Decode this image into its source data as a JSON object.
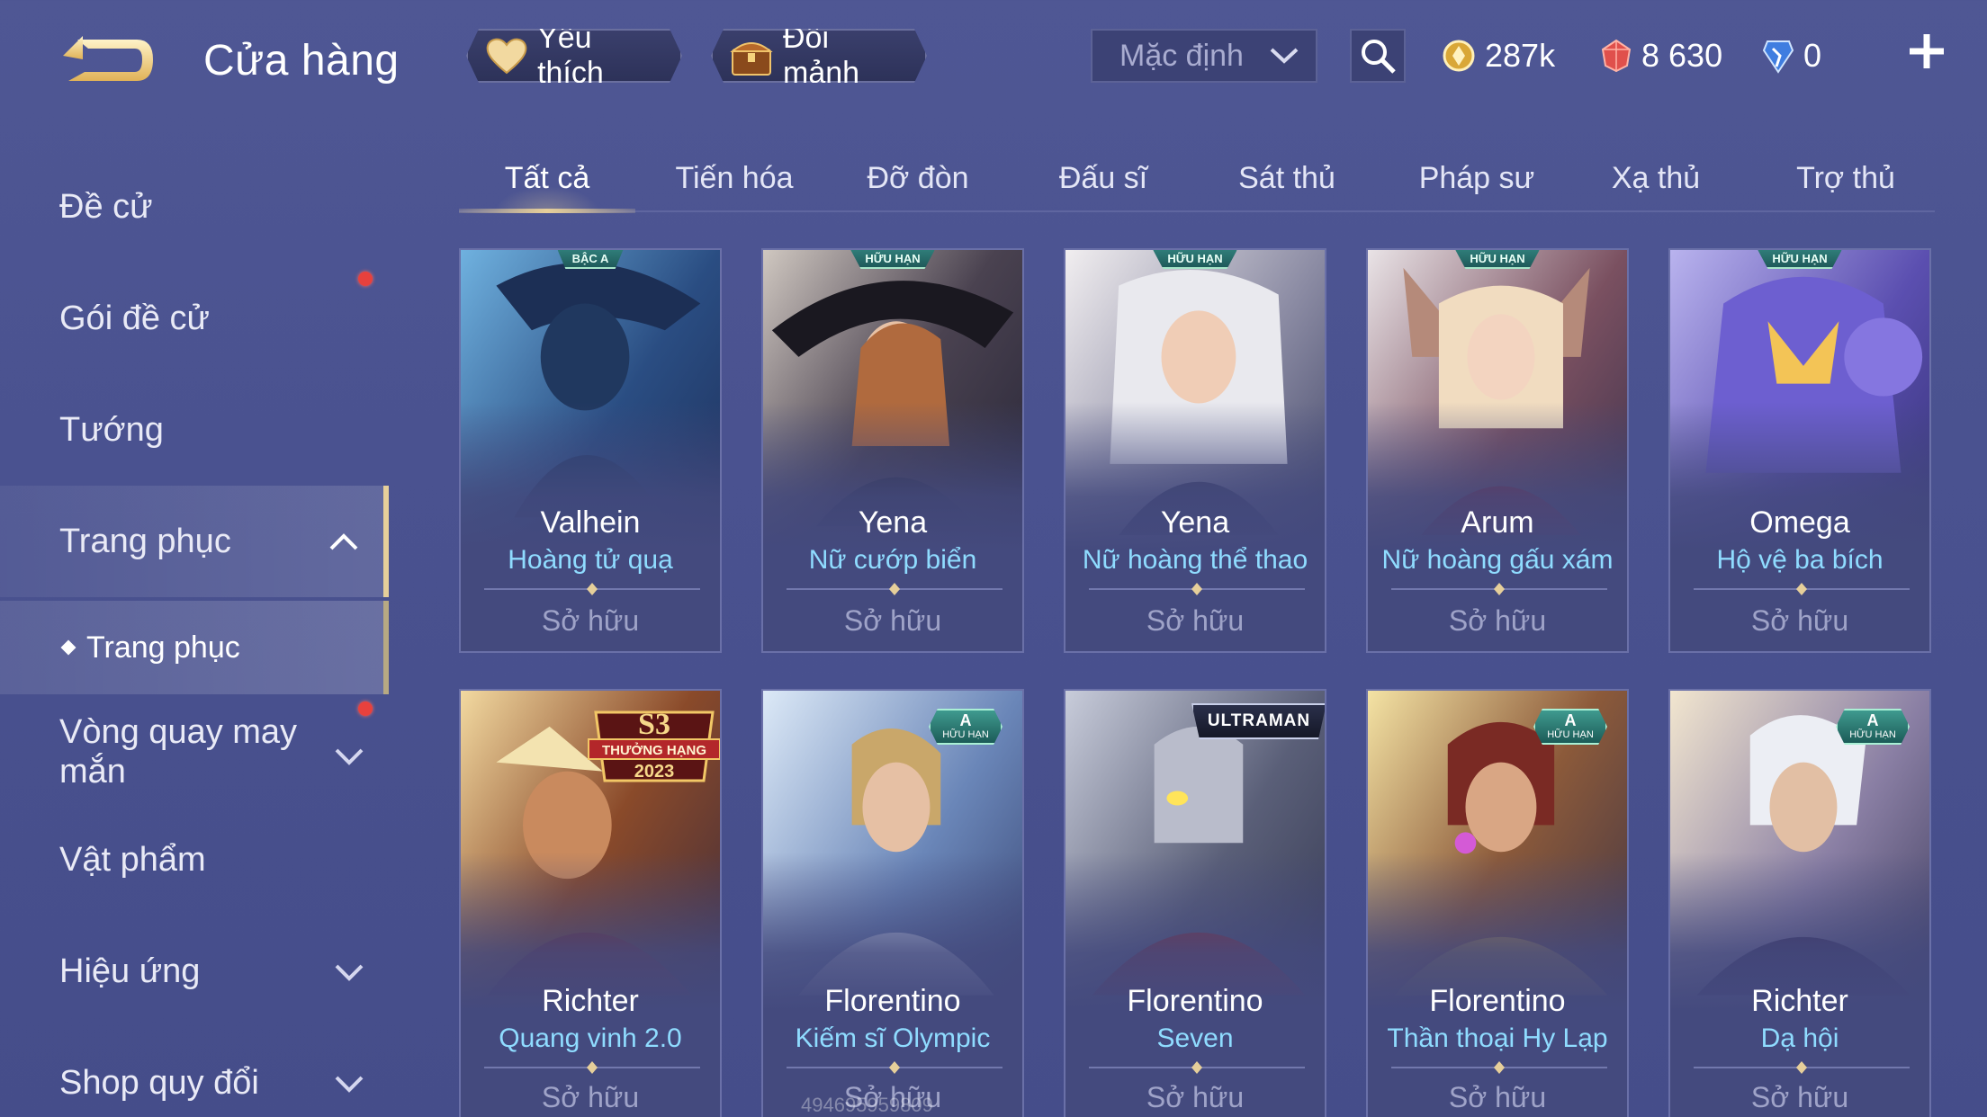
{
  "header": {
    "title": "Cửa hàng",
    "favorites_label": "Yêu thích",
    "shard_exchange_label": "Đổi mảnh",
    "sort_value": "Mặc định",
    "currencies": {
      "gold": "287k",
      "ruby": "8 630",
      "diamond": "0"
    }
  },
  "sidebar": {
    "items": [
      {
        "label": "Đề cử"
      },
      {
        "label": "Gói đề cử"
      },
      {
        "label": "Tướng"
      },
      {
        "label": "Trang phục"
      },
      {
        "label": "Vòng quay may mắn"
      },
      {
        "label": "Vật phẩm"
      },
      {
        "label": "Hiệu ứng"
      },
      {
        "label": "Shop quy đổi"
      }
    ],
    "sub_item": {
      "label": "Trang phục"
    }
  },
  "tabs": [
    {
      "label": "Tất cả",
      "active": true
    },
    {
      "label": "Tiến hóa"
    },
    {
      "label": "Đỡ đòn"
    },
    {
      "label": "Đấu sĩ"
    },
    {
      "label": "Sát thủ"
    },
    {
      "label": "Pháp sư"
    },
    {
      "label": "Xạ thủ"
    },
    {
      "label": "Trợ thủ"
    }
  ],
  "cards": [
    {
      "hero": "Valhein",
      "skin": "Hoàng tử quạ",
      "status": "Sở hữu",
      "badge": "BẬC A"
    },
    {
      "hero": "Yena",
      "skin": "Nữ cướp biển",
      "status": "Sở hữu",
      "badge": "HỮU HẠN"
    },
    {
      "hero": "Yena",
      "skin": "Nữ hoàng thể thao",
      "status": "Sở hữu",
      "badge": "HỮU HẠN"
    },
    {
      "hero": "Arum",
      "skin": "Nữ hoàng gấu xám",
      "status": "Sở hữu",
      "badge": "HỮU HẠN"
    },
    {
      "hero": "Omega",
      "skin": "Hộ vệ ba bích",
      "status": "Sở hữu",
      "badge": "HỮU HẠN"
    },
    {
      "hero": "Richter",
      "skin": "Quang vinh 2.0",
      "status": "Sở hữu",
      "badge_s3": "S3",
      "badge_s3_sub": "THƯỞNG HẠNG",
      "badge_s3_year": "2023"
    },
    {
      "hero": "Florentino",
      "skin": "Kiếm sĩ Olympic",
      "status": "Sở hữu",
      "badge_a": "A",
      "badge_a_sub": "HỮU HẠN"
    },
    {
      "hero": "Florentino",
      "skin": "Seven",
      "status": "Sở hữu",
      "badge_ultraman": "ULTRAMAN"
    },
    {
      "hero": "Florentino",
      "skin": "Thần thoại Hy Lạp",
      "status": "Sở hữu",
      "badge_a": "A",
      "badge_a_sub": "HỮU HẠN"
    },
    {
      "hero": "Richter",
      "skin": "Dạ hội",
      "status": "Sở hữu",
      "badge_a": "A",
      "badge_a_sub": "HỮU HẠN"
    }
  ],
  "watermark": "494695959809",
  "colors": {
    "accent_gold": "#e6cf9a",
    "skin_name": "#8fdcff",
    "owned": "#9fa3c8",
    "notification": "#e8413d"
  }
}
